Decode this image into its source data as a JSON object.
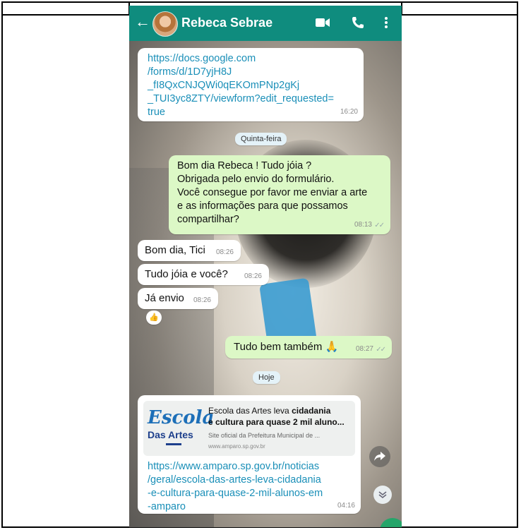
{
  "contact": {
    "name": "Rebeca Sebrae"
  },
  "messages": [
    {
      "type": "in",
      "text": "https://docs.google.com\n/forms/d/1D7yjH8J\n_fI8QxCNJQWi0qEKOmPNp2gKj\n_TUI3yc8ZTY/viewform?edit_requested=\ntrue",
      "time": "16:20"
    },
    {
      "type": "out",
      "text": "Bom dia Rebeca ! Tudo jóia ?\nObrigada pelo envio do formulário.\nVocê consegue por favor me enviar a arte\ne as informações para que possamos\ncompartilhar?",
      "time": "08:13"
    },
    {
      "type": "in",
      "text": "Bom dia, Tici",
      "time": "08:26"
    },
    {
      "type": "in",
      "text": "Tudo jóia e você?",
      "time": "08:26"
    },
    {
      "type": "in",
      "text": "Já envio",
      "time": "08:26",
      "reaction": "👍"
    },
    {
      "type": "out",
      "text": "Tudo bem também 🙏",
      "time": "08:27"
    },
    {
      "type": "in",
      "text": "https://www.amparo.sp.gov.br/noticias\n/geral/escola-das-artes-leva-cidadania\n-e-cultura-para-quase-2-mil-alunos-em\n-amparo",
      "time": "04:16"
    }
  ],
  "day_labels": {
    "thursday": "Quinta-feira",
    "today": "Hoje"
  },
  "link_preview": {
    "title_normal": "Escola das Artes leva ",
    "title_bold": "cidadania\ne cultura para quase 2 mil aluno...",
    "description": "Site oficial da Prefeitura Municipal de ...",
    "url": "www.amparo.sp.gov.br",
    "logo_word1": "Escola",
    "logo_word2": "Das Artes"
  },
  "colors": {
    "header": "#0f8c7e",
    "outgoing": "#dcf8c6",
    "incoming": "#ffffff",
    "link": "#1a8fb8"
  },
  "icons": [
    "back-arrow-icon",
    "video-call-icon",
    "phone-call-icon",
    "more-options-icon",
    "forward-icon",
    "scroll-down-icon",
    "read-receipt-icon"
  ]
}
